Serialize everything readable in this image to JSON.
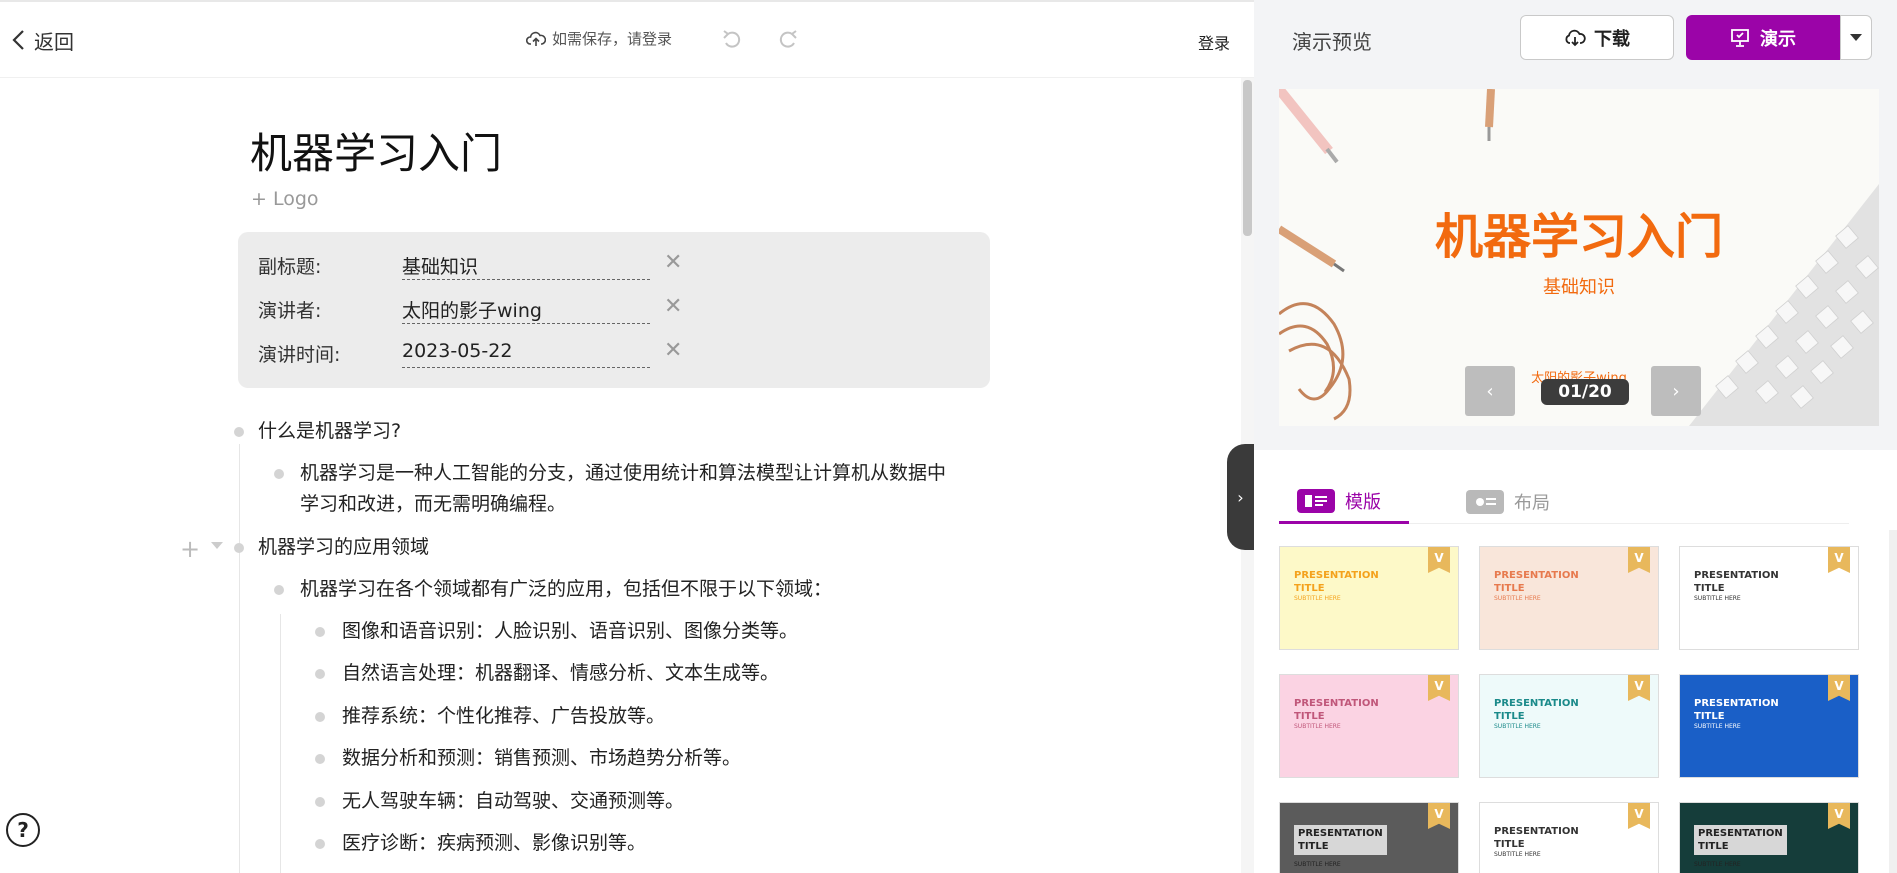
{
  "header": {
    "back_label": "返回",
    "cloud_status": "如需保存，请登录",
    "login_label": "登录"
  },
  "doc": {
    "title": "机器学习入门",
    "add_logo": "+ Logo",
    "meta": [
      {
        "label": "副标题:",
        "value": "基础知识"
      },
      {
        "label": "演讲者:",
        "value": "太阳的影子wing"
      },
      {
        "label": "演讲时间:",
        "value": "2023-05-22"
      }
    ],
    "outline": [
      {
        "level": 1,
        "text": "什么是机器学习?"
      },
      {
        "level": 2,
        "text": "机器学习是一种人工智能的分支，通过使用统计和算法模型让计算机从数据中学习和改进，而无需明确编程。"
      },
      {
        "level": 1,
        "text": "机器学习的应用领域"
      },
      {
        "level": 2,
        "text": "机器学习在各个领域都有广泛的应用，包括但不限于以下领域："
      },
      {
        "level": 3,
        "text": "图像和语音识别：人脸识别、语音识别、图像分类等。"
      },
      {
        "level": 3,
        "text": "自然语言处理：机器翻译、情感分析、文本生成等。"
      },
      {
        "level": 3,
        "text": "推荐系统：个性化推荐、广告投放等。"
      },
      {
        "level": 3,
        "text": "数据分析和预测：销售预测、市场趋势分析等。"
      },
      {
        "level": 3,
        "text": "无人驾驶车辆：自动驾驶、交通预测等。"
      },
      {
        "level": 3,
        "text": "医疗诊断：疾病预测、影像识别等。"
      }
    ]
  },
  "panel": {
    "preview_label": "演示预览",
    "download_label": "下载",
    "present_label": "演示",
    "slide": {
      "title": "机器学习入门",
      "subtitle": "基础知识",
      "author": "太阳的影子wing",
      "counter": "01/20"
    },
    "tabs": [
      {
        "label": "模版",
        "active": true
      },
      {
        "label": "布局",
        "active": false
      }
    ],
    "template_badge": "V",
    "templates": [
      {
        "title": "PRESENTATION\nTITLE",
        "subtitle": "SUBTITLE HERE",
        "bg": "#fdf9c8",
        "fg": "#f4a21c"
      },
      {
        "title": "PRESENTATION\nTITLE",
        "subtitle": "SUBTITLE HERE",
        "bg": "#f9e6da",
        "fg": "#e77a4e"
      },
      {
        "title": "PRESENTATION\nTITLE",
        "subtitle": "SUBTITLE HERE",
        "bg": "#ffffff",
        "fg": "#333333"
      },
      {
        "title": "PRESENTATION\nTITLE",
        "subtitle": "SUBTITLE HERE",
        "bg": "#fbd3e3",
        "fg": "#c0577a"
      },
      {
        "title": "PRESENTATION\nTITLE",
        "subtitle": "SUBTITLE HERE",
        "bg": "#eefafa",
        "fg": "#1b8a8a"
      },
      {
        "title": "PRESENTATION\nTITLE",
        "subtitle": "SUBTITLE HERE",
        "bg": "#1a5fc7",
        "fg": "#ffffff"
      },
      {
        "title": "PRESENTATION\nTITLE",
        "subtitle": "SUBTITLE HERE",
        "bg": "#5b5b5b",
        "fg": "#222222",
        "ratio": "4:3"
      },
      {
        "title": "PRESENTATION\nTITLE",
        "subtitle": "SUBTITLE HERE",
        "bg": "#ffffff",
        "fg": "#333333"
      },
      {
        "title": "PRESENTATION\nTITLE",
        "subtitle": "SUBTITLE HERE",
        "bg": "#153d3a",
        "fg": "#222222",
        "ratio": "4:3"
      }
    ]
  },
  "colors": {
    "accent": "#9b04a8",
    "slide_orange": "#f26a0f"
  }
}
